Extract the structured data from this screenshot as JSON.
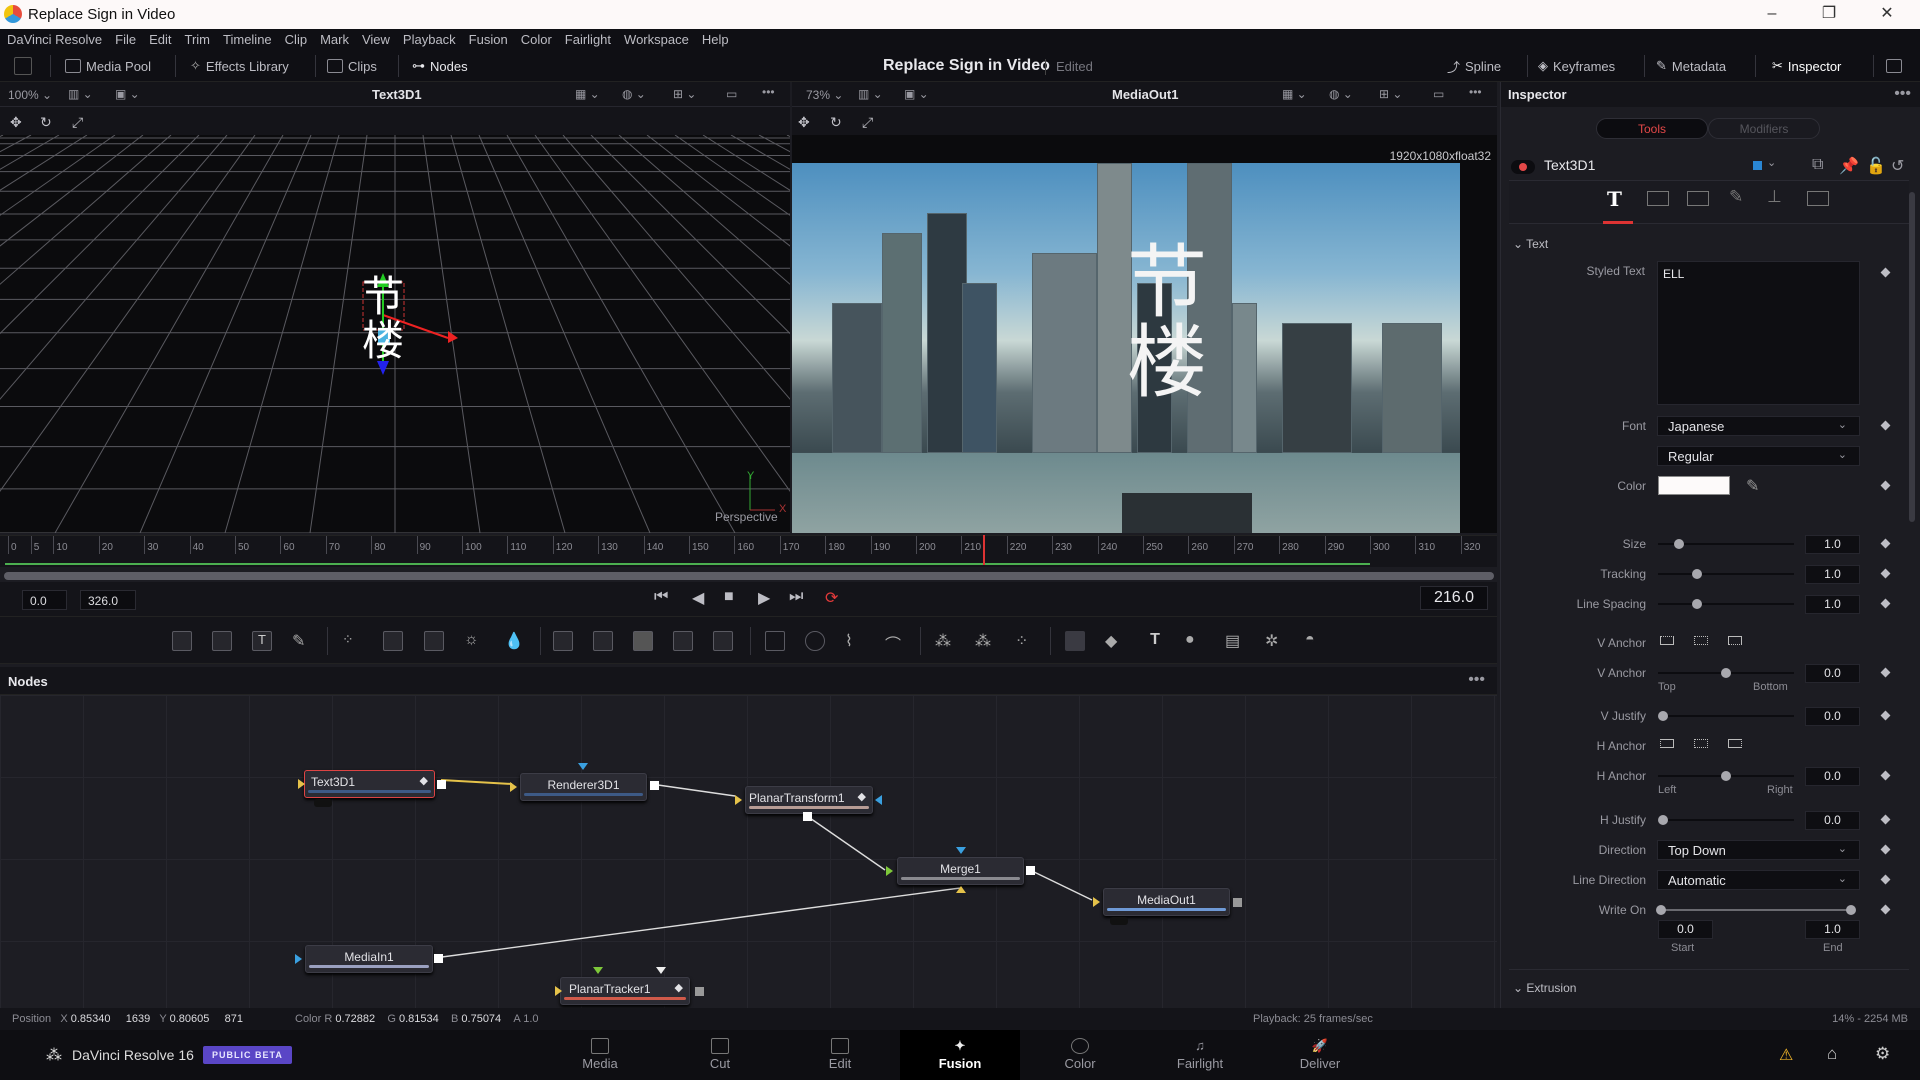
{
  "window": {
    "title": "Replace Sign in Video",
    "controls": [
      "–",
      "❐",
      "✕"
    ]
  },
  "menu": [
    "DaVinci Resolve",
    "File",
    "Edit",
    "Trim",
    "Timeline",
    "Clip",
    "Mark",
    "View",
    "Playback",
    "Fusion",
    "Color",
    "Fairlight",
    "Workspace",
    "Help"
  ],
  "toolbar": {
    "left": [
      {
        "label": "Media Pool",
        "icon": "media-pool-icon"
      },
      {
        "label": "Effects Library",
        "icon": "effects-icon"
      },
      {
        "label": "Clips",
        "icon": "clips-icon"
      },
      {
        "label": "Nodes",
        "icon": "nodes-icon"
      }
    ],
    "project_title": "Replace Sign in Video",
    "project_status": "Edited",
    "right": [
      {
        "label": "Spline",
        "icon": "spline-icon"
      },
      {
        "label": "Keyframes",
        "icon": "keyframes-icon"
      },
      {
        "label": "Metadata",
        "icon": "metadata-icon"
      },
      {
        "label": "Inspector",
        "icon": "inspector-icon"
      }
    ]
  },
  "viewer_left": {
    "zoom": "100%",
    "title": "Text3D1",
    "overlay_label": "Perspective",
    "axis_x": "X",
    "axis_y": "Y",
    "glyphs": [
      "节",
      "楼"
    ]
  },
  "viewer_right": {
    "zoom": "73%",
    "title": "MediaOut1",
    "resolution": "1920x1080xfloat32",
    "glyphs": [
      "节",
      "楼"
    ]
  },
  "timeline": {
    "ticks": [
      "0",
      "5",
      "10",
      "20",
      "30",
      "40",
      "50",
      "60",
      "70",
      "80",
      "90",
      "100",
      "110",
      "120",
      "130",
      "140",
      "150",
      "160",
      "170",
      "180",
      "190",
      "200",
      "210",
      "220",
      "230",
      "240",
      "250",
      "260",
      "270",
      "280",
      "290",
      "300",
      "310",
      "320"
    ],
    "start": "0.0",
    "end": "326.0",
    "current_frame": "216.0",
    "playhead": 216,
    "render_end": 300,
    "max": 326
  },
  "nodes_panel": {
    "title": "Nodes",
    "nodes": [
      {
        "name": "Text3D1",
        "bar": "#3d5a86",
        "selected": true
      },
      {
        "name": "Renderer3D1",
        "bar": "#3d5a86"
      },
      {
        "name": "PlanarTransform1",
        "bar": "#b79c95"
      },
      {
        "name": "Merge1",
        "bar": "#8a8a90"
      },
      {
        "name": "MediaOut1",
        "bar": "#6f9ad6"
      },
      {
        "name": "MediaIn1",
        "bar": "#9aa0c0"
      },
      {
        "name": "PlanarTracker1",
        "bar": "#d05a4a"
      }
    ]
  },
  "inspector": {
    "title": "Inspector",
    "tabs": [
      "Tools",
      "Modifiers"
    ],
    "active_tab": "Tools",
    "tool_name": "Text3D1",
    "section_text": "Text",
    "section_extrusion": "Extrusion",
    "styled_text_label": "Styled Text",
    "styled_text": "ELL",
    "font_label": "Font",
    "font": "Japanese",
    "font_style": "Regular",
    "color_label": "Color",
    "color_value": "#ffffff",
    "params": [
      {
        "label": "Size",
        "value": "1.0",
        "pos": 0.13
      },
      {
        "label": "Tracking",
        "value": "1.0",
        "pos": 0.27
      },
      {
        "label": "Line Spacing",
        "value": "1.0",
        "pos": 0.27
      }
    ],
    "v_anchor_label": "V Anchor",
    "v_anchor_value": "0.0",
    "v_anchor_min": "Top",
    "v_anchor_max": "Bottom",
    "v_justify_label": "V Justify",
    "v_justify_value": "0.0",
    "h_anchor_label": "H Anchor",
    "h_anchor_value": "0.0",
    "h_anchor_min": "Left",
    "h_anchor_max": "Right",
    "h_justify_label": "H Justify",
    "h_justify_value": "0.0",
    "direction_label": "Direction",
    "direction": "Top Down",
    "line_direction_label": "Line Direction",
    "line_direction": "Automatic",
    "write_on_label": "Write On",
    "write_on_start": "0.0",
    "write_on_end": "1.0",
    "start_label": "Start",
    "end_label": "End"
  },
  "status": {
    "position_label": "Position",
    "x_label": "X",
    "x": "0.85340",
    "px": "1639",
    "y_label": "Y",
    "y": "0.80605",
    "py": "871",
    "color_label": "Color",
    "r_label": "R",
    "r": "0.72882",
    "g_label": "G",
    "g": "0.81534",
    "b_label": "B",
    "b": "0.75074",
    "a_label": "A",
    "a": "1.0",
    "playback": "Playback: 25 frames/sec",
    "memory": "14% - 2254 MB"
  },
  "pagebar": {
    "app": "DaVinci Resolve 16",
    "badge": "PUBLIC BETA",
    "pages": [
      "Media",
      "Cut",
      "Edit",
      "Fusion",
      "Color",
      "Fairlight",
      "Deliver"
    ],
    "active": "Fusion"
  }
}
